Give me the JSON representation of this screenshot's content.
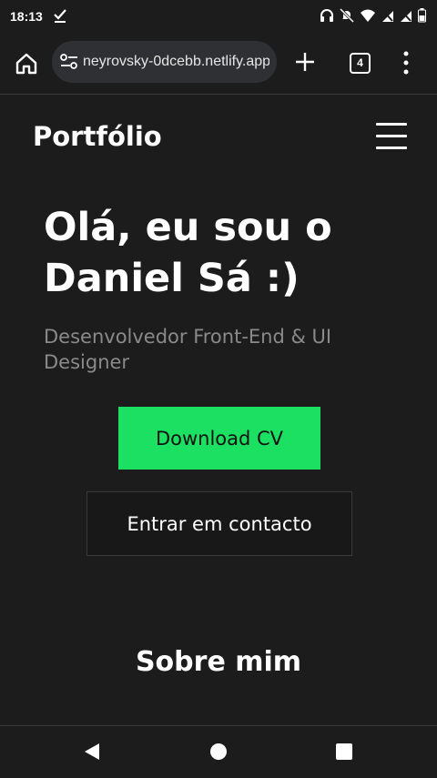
{
  "status_bar": {
    "time": "18:13",
    "icons": [
      "check-icon",
      "headphones-icon",
      "mute-icon",
      "wifi-icon",
      "signal-icon",
      "signal-icon",
      "battery-icon"
    ]
  },
  "browser": {
    "url": "neyrovsky-0dcebb.netlify.app",
    "tab_count": "4"
  },
  "site": {
    "brand": "Portfólio",
    "hero_title": "Olá, eu sou o Daniel Sá :)",
    "hero_subtitle": "Desenvolvedor Front-End & UI Designer",
    "download_button": "Download CV",
    "contact_button": "Entrar em contacto",
    "section_title": "Sobre mim"
  },
  "colors": {
    "background": "#1c1c1c",
    "accent": "#1ce062",
    "muted_text": "#8a8a8a"
  }
}
